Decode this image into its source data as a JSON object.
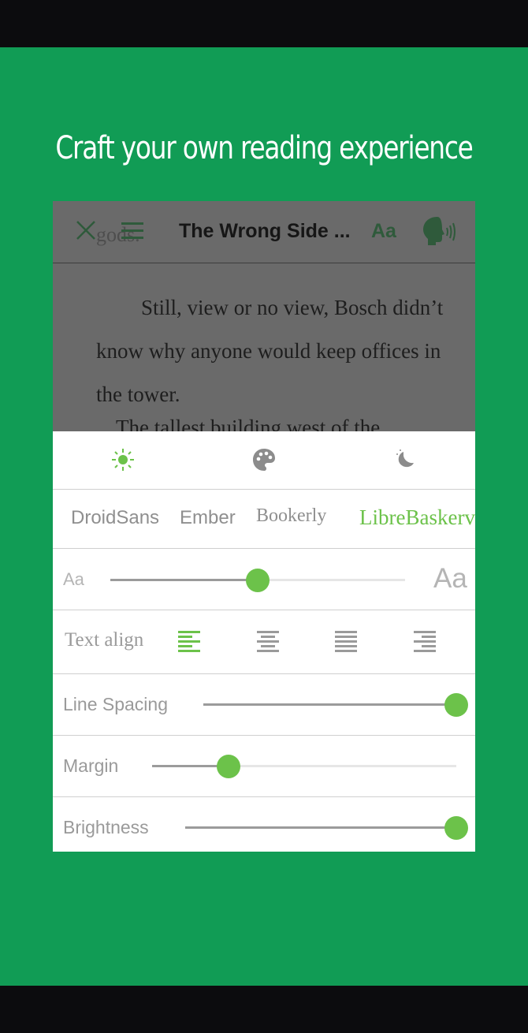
{
  "promo": {
    "headline": "Craft your own reading experience",
    "background_color": "#119c55"
  },
  "reader": {
    "toolbar": {
      "title": "The Wrong Side ...",
      "font_settings_label": "Aa"
    },
    "ghost_text": "gods.",
    "paragraph_1": "Still, view or no view, Bosch didn’t know why anyone would keep offices in the tower.",
    "paragraph_2": "The tallest building west of the"
  },
  "settings": {
    "themes": [
      "sun-icon",
      "palette-icon",
      "moon-icon"
    ],
    "active_theme": "sun-icon",
    "fonts": [
      "DroidSans",
      "Ember",
      "Bookerly",
      "LibreBaskerville"
    ],
    "active_font": "LibreBaskerville",
    "font_size": {
      "small_glyph": "Aa",
      "large_glyph": "Aa",
      "value_fraction": 0.5
    },
    "text_align": {
      "label": "Text align",
      "options": [
        "align-left-icon",
        "align-center-icon",
        "align-justify-icon",
        "align-right-icon"
      ],
      "active": "align-left-icon"
    },
    "line_spacing": {
      "label": "Line Spacing",
      "value_fraction": 1.0
    },
    "margin": {
      "label": "Margin",
      "value_fraction": 0.25
    },
    "brightness": {
      "label": "Brightness",
      "value_fraction": 1.0
    },
    "accent_color": "#6cc24a"
  }
}
